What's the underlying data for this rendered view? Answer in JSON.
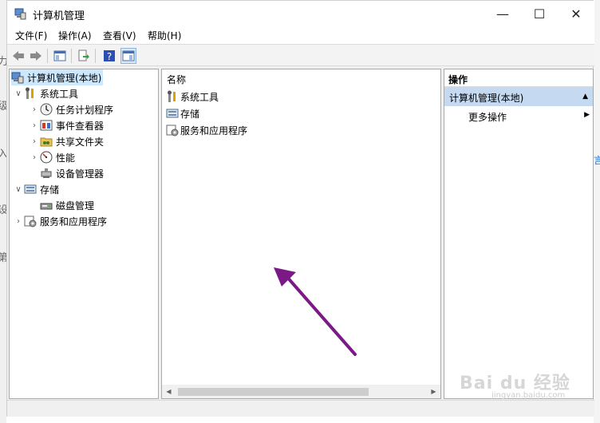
{
  "window": {
    "title": "计算机管理",
    "controls": {
      "minimize": "—",
      "maximize": "☐",
      "close": "✕"
    }
  },
  "menu": [
    "文件(F)",
    "操作(A)",
    "查看(V)",
    "帮助(H)"
  ],
  "toolbar": [
    "back-icon",
    "forward-icon",
    "show-hide-tree-icon",
    "export-list-icon",
    "help-icon",
    "console-view-icon"
  ],
  "tree": {
    "root": "计算机管理(本地)",
    "items": [
      {
        "label": "系统工具",
        "level": 1,
        "expanded": true,
        "icon": "tools-icon"
      },
      {
        "label": "任务计划程序",
        "level": 2,
        "expanded": false,
        "icon": "task-scheduler-icon"
      },
      {
        "label": "事件查看器",
        "level": 2,
        "expanded": false,
        "icon": "event-viewer-icon"
      },
      {
        "label": "共享文件夹",
        "level": 2,
        "expanded": false,
        "icon": "shared-folders-icon"
      },
      {
        "label": "性能",
        "level": 2,
        "expanded": false,
        "icon": "performance-icon"
      },
      {
        "label": "设备管理器",
        "level": 2,
        "expanded": null,
        "icon": "device-manager-icon"
      },
      {
        "label": "存储",
        "level": 1,
        "expanded": true,
        "icon": "storage-icon"
      },
      {
        "label": "磁盘管理",
        "level": 2,
        "expanded": null,
        "icon": "disk-management-icon"
      },
      {
        "label": "服务和应用程序",
        "level": 1,
        "expanded": false,
        "icon": "services-icon"
      }
    ]
  },
  "center": {
    "column_header": "名称",
    "items": [
      "系统工具",
      "存储",
      "服务和应用程序"
    ]
  },
  "actions": {
    "header": "操作",
    "selected": "计算机管理(本地)",
    "more": "更多操作"
  },
  "background_fragments": {
    "left": [
      "力",
      "级",
      "入",
      "设",
      "第"
    ],
    "right": [
      "言"
    ]
  },
  "watermark": {
    "text": "Bai du 经验",
    "sub": "jingyan.baidu.com"
  },
  "colors": {
    "selection": "#cce8ff",
    "action_selected": "#c5d9f1",
    "annotation_arrow": "#7b1a86"
  }
}
